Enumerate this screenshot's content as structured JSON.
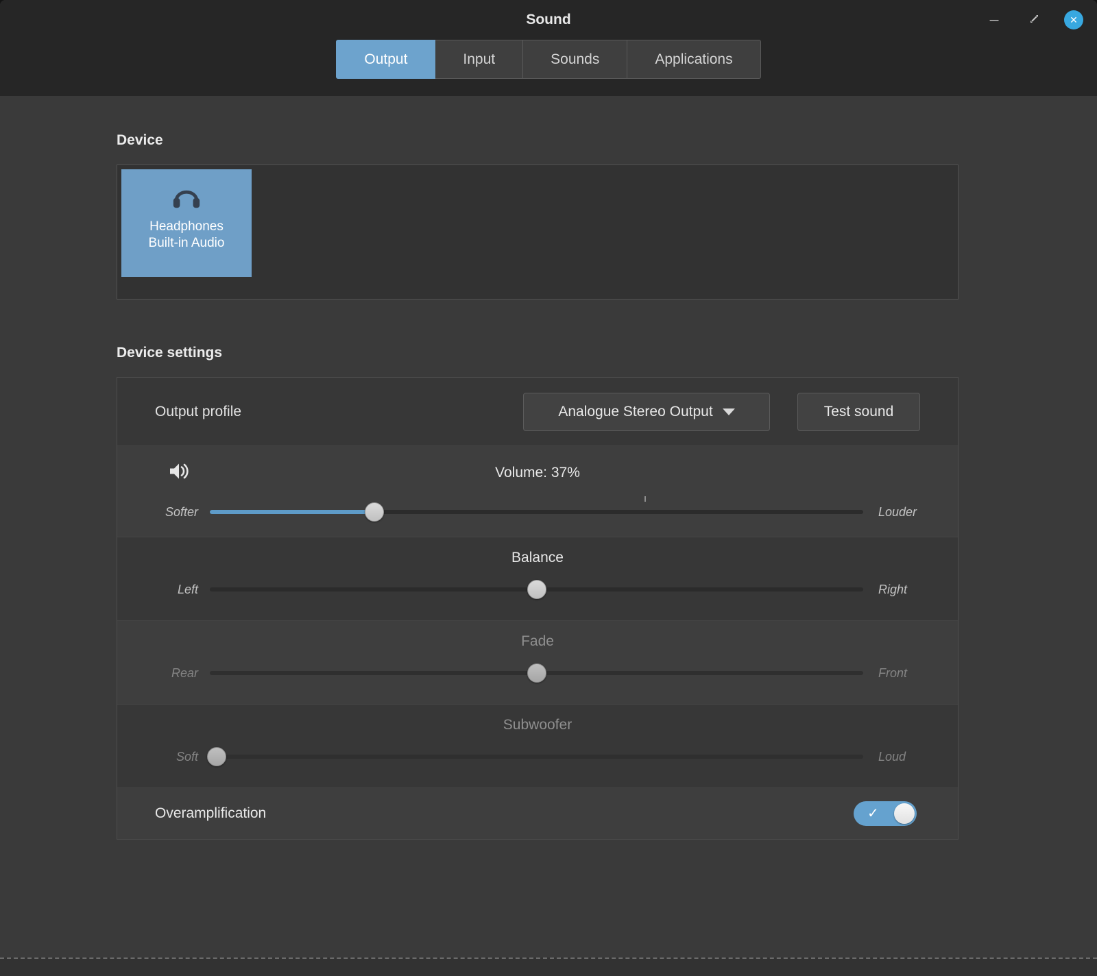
{
  "window": {
    "title": "Sound",
    "controls": {
      "minimize_glyph": "─",
      "close_glyph": "✕"
    }
  },
  "tabs": [
    {
      "label": "Output",
      "active": true
    },
    {
      "label": "Input",
      "active": false
    },
    {
      "label": "Sounds",
      "active": false
    },
    {
      "label": "Applications",
      "active": false
    }
  ],
  "device_section": {
    "heading": "Device",
    "devices": [
      {
        "line1": "Headphones",
        "line2": "Built-in Audio",
        "selected": true,
        "icon": "headphones-icon"
      }
    ]
  },
  "settings_section": {
    "heading": "Device settings",
    "output_profile": {
      "label": "Output profile",
      "selected_value": "Analogue Stereo Output",
      "test_button_label": "Test sound"
    },
    "volume": {
      "caption": "Volume: 37%",
      "left_label": "Softer",
      "right_label": "Louder",
      "handle_percent": 25.2,
      "marker_percent": 66.5,
      "icon": "speaker-volume-icon"
    },
    "balance": {
      "caption": "Balance",
      "left_label": "Left",
      "right_label": "Right",
      "handle_percent": 50,
      "disabled": false
    },
    "fade": {
      "caption": "Fade",
      "left_label": "Rear",
      "right_label": "Front",
      "handle_percent": 50,
      "disabled": true
    },
    "subwoofer": {
      "caption": "Subwoofer",
      "left_label": "Soft",
      "right_label": "Loud",
      "handle_percent": 1,
      "disabled": true
    },
    "overamplification": {
      "label": "Overamplification",
      "enabled": true,
      "check_glyph": "✓"
    }
  },
  "colors": {
    "accent_blue": "#6da3cd",
    "slider_fill_blue": "#5e9bc8",
    "close_button_blue": "#38a8e0",
    "header_bg": "#262626",
    "window_bg": "#3a3a3a",
    "panel_bg": "#373737",
    "panel_border": "#4e4e4e"
  }
}
